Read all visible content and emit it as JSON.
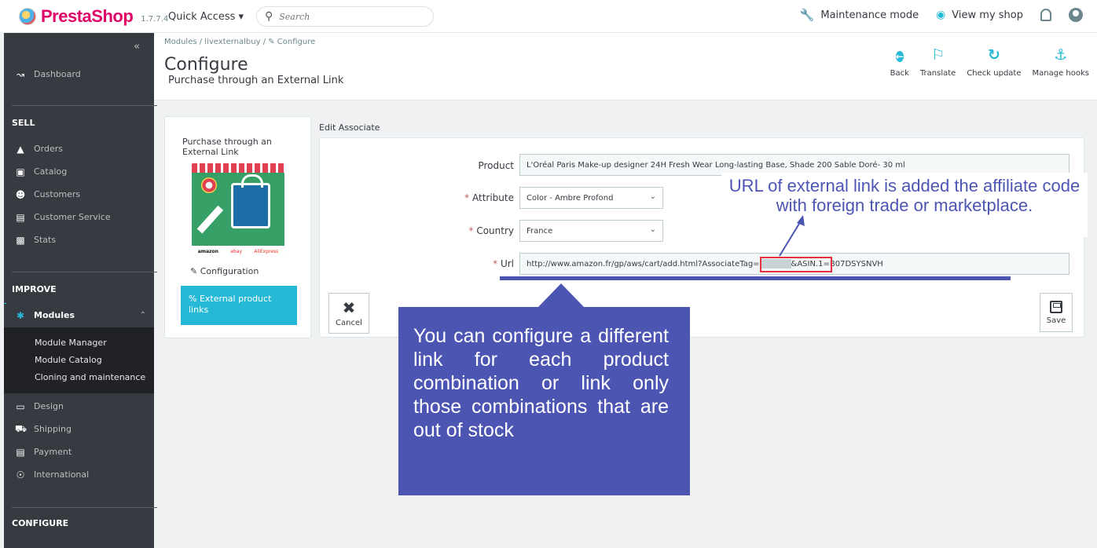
{
  "topbar": {
    "brand": "PrestaShop",
    "version": "1.7.7.4",
    "quick_access": "Quick Access ▾",
    "search_placeholder": "Search",
    "maintenance": "Maintenance mode",
    "view_shop": "View my shop"
  },
  "sidebar": {
    "collapse": "«",
    "dashboard": "Dashboard",
    "sell_label": "SELL",
    "sell_items": [
      "Orders",
      "Catalog",
      "Customers",
      "Customer Service",
      "Stats"
    ],
    "improve_label": "IMPROVE",
    "modules": "Modules",
    "module_sub": [
      "Module Manager",
      "Module Catalog",
      "Cloning and maintenance"
    ],
    "improve_items": [
      "Design",
      "Shipping",
      "Payment",
      "International"
    ],
    "configure_label": "CONFIGURE"
  },
  "header": {
    "breadcrumb": "Modules  /  livexternalbuy  /  ✎ Configure",
    "title": "Configure",
    "subtitle": "Purchase through an External Link",
    "tools": [
      "Back",
      "Translate",
      "Check update",
      "Manage hooks"
    ]
  },
  "module_card": {
    "title": "Purchase through an External Link",
    "brands": [
      "amazon",
      "ebay",
      "AliExpress"
    ],
    "configuration": "Configuration",
    "external_links": "% External product links"
  },
  "form": {
    "heading": "Edit Associate",
    "product_label": "Product",
    "product_value": "L'Oréal Paris Make-up designer 24H Fresh Wear Long-lasting Base, Shade 200 Sable Doré- 30 ml",
    "attribute_label": "Attribute",
    "attribute_value": "Color - Ambre Profond",
    "country_label": "Country",
    "country_value": "France",
    "url_label": "Url",
    "url_prefix": "http://www.amazon.fr/gp/aws/cart/add.html?AssociateTag=",
    "url_suffix": "&ASIN.1=B07DSYSNVH",
    "required_mark": "*",
    "cancel": "Cancel",
    "save": "Save"
  },
  "annotations": {
    "top": "URL of external link is added the affiliate code with foreign trade or marketplace.",
    "box": "You can configure a different link for each product combination or link only those combinations that are out of stock"
  },
  "colors": {
    "accent": "#25b9d7",
    "sidebar": "#363a41",
    "annotation": "#4d55b3",
    "highlight": "#e5323e"
  }
}
